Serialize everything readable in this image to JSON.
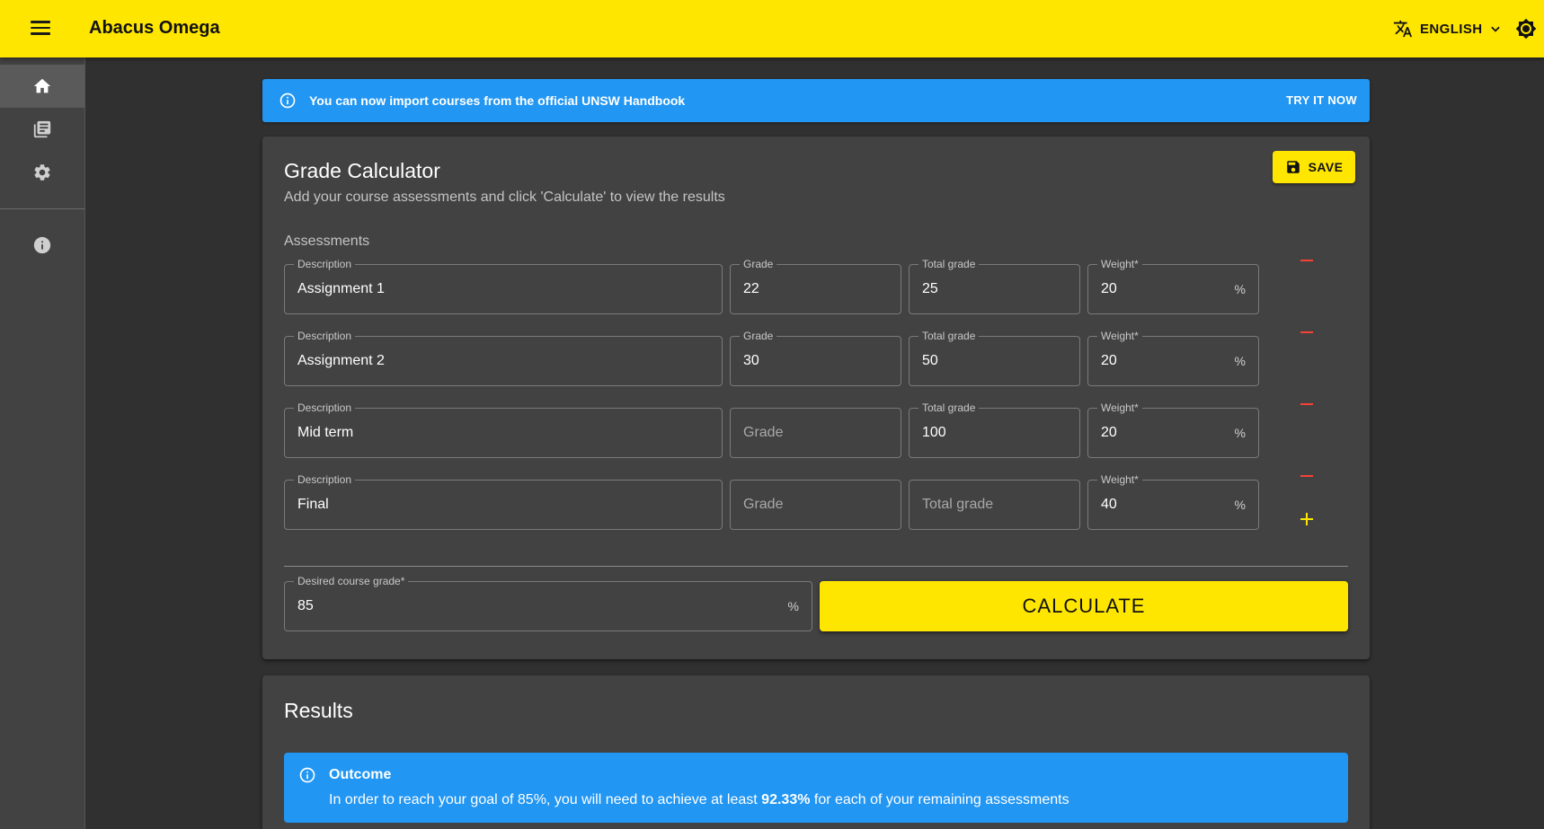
{
  "app": {
    "title": "Abacus Omega",
    "language": "ENGLISH",
    "icons": {
      "menu": "hamburger-menu-icon",
      "translate": "translate-icon",
      "theme": "brightness-icon"
    }
  },
  "colors": {
    "primary": "#ffe600",
    "info": "#2196f3",
    "danger": "#f44336",
    "background": "#303030",
    "surface": "#424242"
  },
  "sidebar": {
    "items": [
      {
        "name": "home",
        "icon": "home-icon",
        "active": true
      },
      {
        "name": "courses",
        "icon": "library-books-icon",
        "active": false
      },
      {
        "name": "settings",
        "icon": "gear-icon",
        "active": false
      },
      {
        "name": "about",
        "icon": "info-icon",
        "active": false
      }
    ]
  },
  "banner": {
    "text": "You can now import courses from the official UNSW Handbook",
    "action": "TRY IT NOW"
  },
  "calculator": {
    "title": "Grade Calculator",
    "subtitle": "Add your course assessments and click 'Calculate' to view the results",
    "save_label": "SAVE",
    "section_label": "Assessments",
    "labels": {
      "description": "Description",
      "grade": "Grade",
      "total": "Total grade",
      "weight": "Weight*",
      "weight_suffix": "%"
    },
    "assessments": [
      {
        "description": "Assignment 1",
        "grade": "22",
        "total": "25",
        "weight": "20"
      },
      {
        "description": "Assignment 2",
        "grade": "30",
        "total": "50",
        "weight": "20"
      },
      {
        "description": "Mid term",
        "grade": "",
        "total": "100",
        "weight": "20"
      },
      {
        "description": "Final",
        "grade": "",
        "total": "",
        "weight": "40"
      }
    ],
    "desired": {
      "label": "Desired course grade*",
      "value": "85",
      "suffix": "%"
    },
    "calculate_label": "CALCULATE"
  },
  "results": {
    "title": "Results",
    "outcome_title": "Outcome",
    "outcome_pre": "In order to reach your goal of 85%, you will need to achieve at least ",
    "outcome_value": "92.33%",
    "outcome_post": " for each of your remaining assessments"
  }
}
